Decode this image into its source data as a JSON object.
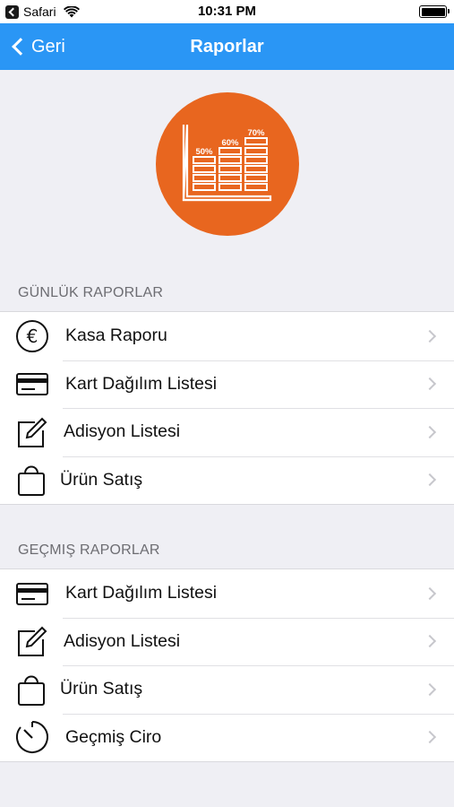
{
  "status_bar": {
    "app_name": "Safari",
    "time": "10:31 PM",
    "back_icon": "back-to-app-icon",
    "wifi_icon": "wifi-icon",
    "battery_icon": "battery-icon"
  },
  "nav": {
    "back_label": "Geri",
    "title": "Raporlar"
  },
  "hero": {
    "icon": "bar-chart-icon",
    "color": "#e8661f",
    "bar_labels": [
      "50%",
      "60%",
      "70%"
    ]
  },
  "sections": [
    {
      "header": "GÜNLÜK RAPORLAR",
      "items": [
        {
          "label": "Kasa Raporu",
          "icon": "euro-icon"
        },
        {
          "label": "Kart Dağılım Listesi",
          "icon": "credit-card-icon"
        },
        {
          "label": "Adisyon Listesi",
          "icon": "edit-icon"
        },
        {
          "label": "Ürün Satış",
          "icon": "shopping-bag-icon"
        }
      ]
    },
    {
      "header": "GEÇMIŞ RAPORLAR",
      "items": [
        {
          "label": "Kart Dağılım Listesi",
          "icon": "credit-card-icon"
        },
        {
          "label": "Adisyon Listesi",
          "icon": "edit-icon"
        },
        {
          "label": "Ürün Satış",
          "icon": "shopping-bag-icon"
        },
        {
          "label": "Geçmiş Ciro",
          "icon": "timer-icon"
        }
      ]
    }
  ],
  "colors": {
    "nav_bar": "#2a96f5",
    "background": "#efeff4",
    "accent": "#e8661f"
  }
}
